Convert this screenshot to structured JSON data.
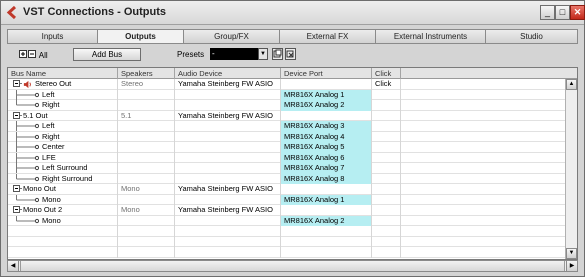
{
  "window": {
    "title": "VST Connections - Outputs",
    "buttons": {
      "minimize": "_",
      "maximize": "□",
      "close": "✕"
    }
  },
  "tabs": [
    {
      "label": "Inputs",
      "active": false
    },
    {
      "label": "Outputs",
      "active": true
    },
    {
      "label": "Group/FX",
      "active": false
    },
    {
      "label": "External FX",
      "active": false
    },
    {
      "label": "External Instruments",
      "active": false
    },
    {
      "label": "Studio",
      "active": false
    }
  ],
  "toolbar": {
    "expand_all_label": "All",
    "add_bus_label": "Add Bus",
    "presets_label": "Presets",
    "presets_value": "-"
  },
  "columns": [
    "Bus Name",
    "Speakers",
    "Audio Device",
    "Device Port",
    "Click"
  ],
  "rows": [
    {
      "type": "bus",
      "name": "Stereo Out",
      "speakers": "Stereo",
      "device": "Yamaha Steinberg FW ASIO",
      "port": "",
      "click": "Click",
      "speaker_icon": true
    },
    {
      "type": "channel",
      "name": "Left",
      "speakers": "",
      "device": "",
      "port": "MR816X Analog 1",
      "click": ""
    },
    {
      "type": "channel",
      "name": "Right",
      "speakers": "",
      "device": "",
      "port": "MR816X Analog 2",
      "click": ""
    },
    {
      "type": "bus",
      "name": "5.1 Out",
      "speakers": "5.1",
      "device": "Yamaha Steinberg FW ASIO",
      "port": "",
      "click": ""
    },
    {
      "type": "channel",
      "name": "Left",
      "speakers": "",
      "device": "",
      "port": "MR816X Analog 3",
      "click": ""
    },
    {
      "type": "channel",
      "name": "Right",
      "speakers": "",
      "device": "",
      "port": "MR816X Analog 4",
      "click": ""
    },
    {
      "type": "channel",
      "name": "Center",
      "speakers": "",
      "device": "",
      "port": "MR816X Analog 5",
      "click": ""
    },
    {
      "type": "channel",
      "name": "LFE",
      "speakers": "",
      "device": "",
      "port": "MR816X Analog 6",
      "click": ""
    },
    {
      "type": "channel",
      "name": "Left Surround",
      "speakers": "",
      "device": "",
      "port": "MR816X Analog 7",
      "click": ""
    },
    {
      "type": "channel",
      "name": "Right Surround",
      "speakers": "",
      "device": "",
      "port": "MR816X Analog 8",
      "click": ""
    },
    {
      "type": "bus",
      "name": "Mono Out",
      "speakers": "Mono",
      "device": "Yamaha Steinberg FW ASIO",
      "port": "",
      "click": ""
    },
    {
      "type": "channel",
      "name": "Mono",
      "speakers": "",
      "device": "",
      "port": "MR816X Analog 1",
      "click": ""
    },
    {
      "type": "bus",
      "name": "Mono Out 2",
      "speakers": "Mono",
      "device": "Yamaha Steinberg FW ASIO",
      "port": "",
      "click": ""
    },
    {
      "type": "channel",
      "name": "Mono",
      "speakers": "",
      "device": "",
      "port": "MR816X Analog 2",
      "click": ""
    }
  ],
  "colors": {
    "port_highlight": "#b6eef2",
    "close_button": "#c2281a",
    "speaker_icon": "#c0392b"
  },
  "icons": {
    "app": "steinberg-logo-icon",
    "expand_all": "expand-collapse-icon",
    "preset_save": "preset-save-icon",
    "preset_delete": "preset-delete-icon"
  }
}
